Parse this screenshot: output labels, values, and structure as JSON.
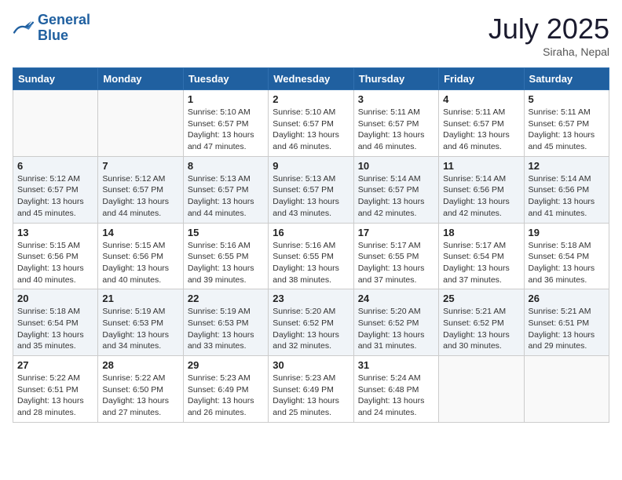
{
  "header": {
    "logo_line1": "General",
    "logo_line2": "Blue",
    "month": "July 2025",
    "location": "Siraha, Nepal"
  },
  "weekdays": [
    "Sunday",
    "Monday",
    "Tuesday",
    "Wednesday",
    "Thursday",
    "Friday",
    "Saturday"
  ],
  "weeks": [
    [
      {
        "day": "",
        "lines": []
      },
      {
        "day": "",
        "lines": []
      },
      {
        "day": "1",
        "lines": [
          "Sunrise: 5:10 AM",
          "Sunset: 6:57 PM",
          "Daylight: 13 hours",
          "and 47 minutes."
        ]
      },
      {
        "day": "2",
        "lines": [
          "Sunrise: 5:10 AM",
          "Sunset: 6:57 PM",
          "Daylight: 13 hours",
          "and 46 minutes."
        ]
      },
      {
        "day": "3",
        "lines": [
          "Sunrise: 5:11 AM",
          "Sunset: 6:57 PM",
          "Daylight: 13 hours",
          "and 46 minutes."
        ]
      },
      {
        "day": "4",
        "lines": [
          "Sunrise: 5:11 AM",
          "Sunset: 6:57 PM",
          "Daylight: 13 hours",
          "and 46 minutes."
        ]
      },
      {
        "day": "5",
        "lines": [
          "Sunrise: 5:11 AM",
          "Sunset: 6:57 PM",
          "Daylight: 13 hours",
          "and 45 minutes."
        ]
      }
    ],
    [
      {
        "day": "6",
        "lines": [
          "Sunrise: 5:12 AM",
          "Sunset: 6:57 PM",
          "Daylight: 13 hours",
          "and 45 minutes."
        ]
      },
      {
        "day": "7",
        "lines": [
          "Sunrise: 5:12 AM",
          "Sunset: 6:57 PM",
          "Daylight: 13 hours",
          "and 44 minutes."
        ]
      },
      {
        "day": "8",
        "lines": [
          "Sunrise: 5:13 AM",
          "Sunset: 6:57 PM",
          "Daylight: 13 hours",
          "and 44 minutes."
        ]
      },
      {
        "day": "9",
        "lines": [
          "Sunrise: 5:13 AM",
          "Sunset: 6:57 PM",
          "Daylight: 13 hours",
          "and 43 minutes."
        ]
      },
      {
        "day": "10",
        "lines": [
          "Sunrise: 5:14 AM",
          "Sunset: 6:57 PM",
          "Daylight: 13 hours",
          "and 42 minutes."
        ]
      },
      {
        "day": "11",
        "lines": [
          "Sunrise: 5:14 AM",
          "Sunset: 6:56 PM",
          "Daylight: 13 hours",
          "and 42 minutes."
        ]
      },
      {
        "day": "12",
        "lines": [
          "Sunrise: 5:14 AM",
          "Sunset: 6:56 PM",
          "Daylight: 13 hours",
          "and 41 minutes."
        ]
      }
    ],
    [
      {
        "day": "13",
        "lines": [
          "Sunrise: 5:15 AM",
          "Sunset: 6:56 PM",
          "Daylight: 13 hours",
          "and 40 minutes."
        ]
      },
      {
        "day": "14",
        "lines": [
          "Sunrise: 5:15 AM",
          "Sunset: 6:56 PM",
          "Daylight: 13 hours",
          "and 40 minutes."
        ]
      },
      {
        "day": "15",
        "lines": [
          "Sunrise: 5:16 AM",
          "Sunset: 6:55 PM",
          "Daylight: 13 hours",
          "and 39 minutes."
        ]
      },
      {
        "day": "16",
        "lines": [
          "Sunrise: 5:16 AM",
          "Sunset: 6:55 PM",
          "Daylight: 13 hours",
          "and 38 minutes."
        ]
      },
      {
        "day": "17",
        "lines": [
          "Sunrise: 5:17 AM",
          "Sunset: 6:55 PM",
          "Daylight: 13 hours",
          "and 37 minutes."
        ]
      },
      {
        "day": "18",
        "lines": [
          "Sunrise: 5:17 AM",
          "Sunset: 6:54 PM",
          "Daylight: 13 hours",
          "and 37 minutes."
        ]
      },
      {
        "day": "19",
        "lines": [
          "Sunrise: 5:18 AM",
          "Sunset: 6:54 PM",
          "Daylight: 13 hours",
          "and 36 minutes."
        ]
      }
    ],
    [
      {
        "day": "20",
        "lines": [
          "Sunrise: 5:18 AM",
          "Sunset: 6:54 PM",
          "Daylight: 13 hours",
          "and 35 minutes."
        ]
      },
      {
        "day": "21",
        "lines": [
          "Sunrise: 5:19 AM",
          "Sunset: 6:53 PM",
          "Daylight: 13 hours",
          "and 34 minutes."
        ]
      },
      {
        "day": "22",
        "lines": [
          "Sunrise: 5:19 AM",
          "Sunset: 6:53 PM",
          "Daylight: 13 hours",
          "and 33 minutes."
        ]
      },
      {
        "day": "23",
        "lines": [
          "Sunrise: 5:20 AM",
          "Sunset: 6:52 PM",
          "Daylight: 13 hours",
          "and 32 minutes."
        ]
      },
      {
        "day": "24",
        "lines": [
          "Sunrise: 5:20 AM",
          "Sunset: 6:52 PM",
          "Daylight: 13 hours",
          "and 31 minutes."
        ]
      },
      {
        "day": "25",
        "lines": [
          "Sunrise: 5:21 AM",
          "Sunset: 6:52 PM",
          "Daylight: 13 hours",
          "and 30 minutes."
        ]
      },
      {
        "day": "26",
        "lines": [
          "Sunrise: 5:21 AM",
          "Sunset: 6:51 PM",
          "Daylight: 13 hours",
          "and 29 minutes."
        ]
      }
    ],
    [
      {
        "day": "27",
        "lines": [
          "Sunrise: 5:22 AM",
          "Sunset: 6:51 PM",
          "Daylight: 13 hours",
          "and 28 minutes."
        ]
      },
      {
        "day": "28",
        "lines": [
          "Sunrise: 5:22 AM",
          "Sunset: 6:50 PM",
          "Daylight: 13 hours",
          "and 27 minutes."
        ]
      },
      {
        "day": "29",
        "lines": [
          "Sunrise: 5:23 AM",
          "Sunset: 6:49 PM",
          "Daylight: 13 hours",
          "and 26 minutes."
        ]
      },
      {
        "day": "30",
        "lines": [
          "Sunrise: 5:23 AM",
          "Sunset: 6:49 PM",
          "Daylight: 13 hours",
          "and 25 minutes."
        ]
      },
      {
        "day": "31",
        "lines": [
          "Sunrise: 5:24 AM",
          "Sunset: 6:48 PM",
          "Daylight: 13 hours",
          "and 24 minutes."
        ]
      },
      {
        "day": "",
        "lines": []
      },
      {
        "day": "",
        "lines": []
      }
    ]
  ]
}
